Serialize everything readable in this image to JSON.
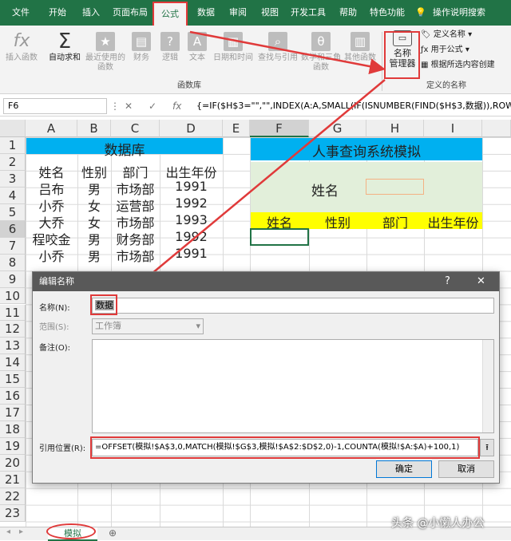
{
  "tabs": [
    "文件",
    "开始",
    "插入",
    "页面布局",
    "公式",
    "数据",
    "审阅",
    "视图",
    "开发工具",
    "帮助",
    "特色功能",
    "操作说明搜索"
  ],
  "ribbon": {
    "func_buttons": [
      {
        "icon": "fx",
        "label": "插入函数"
      },
      {
        "icon": "Σ",
        "label": "自动求和"
      },
      {
        "icon": "★",
        "label": "最近使用的函数"
      },
      {
        "icon": "▤",
        "label": "财务"
      },
      {
        "icon": "?",
        "label": "逻辑"
      },
      {
        "icon": "A",
        "label": "文本"
      },
      {
        "icon": "▦",
        "label": "日期和时间"
      },
      {
        "icon": "⌕",
        "label": "查找与引用"
      },
      {
        "icon": "θ",
        "label": "数学和三角函数"
      },
      {
        "icon": "▥",
        "label": "其他函数"
      }
    ],
    "func_group_label": "函数库",
    "name_manager_line1": "名称",
    "name_manager_line2": "管理器",
    "define_name": "定义名称",
    "use_in_formula": "用于公式",
    "create_from_selection": "根据所选内容创建",
    "defined_names_label": "定义的名称"
  },
  "formula_bar": {
    "name_box": "F6",
    "cancel": "✕",
    "confirm": "✓",
    "fx": "fx",
    "formula": "{=IF($H$3=\"\",\"\",INDEX(A:A,SMALL(IF(ISNUMBER(FIND($H$3,数据)),ROW(数据"
  },
  "columns": [
    "A",
    "B",
    "C",
    "D",
    "E",
    "F",
    "G",
    "H",
    "I"
  ],
  "rows": [
    "1",
    "2",
    "3",
    "4",
    "5",
    "6",
    "7",
    "8",
    "9",
    "10",
    "11",
    "12",
    "13",
    "14",
    "15",
    "16",
    "17",
    "18",
    "19",
    "20",
    "21",
    "22",
    "23"
  ],
  "database": {
    "title": "数据库",
    "headers": [
      "姓名",
      "性别",
      "部门",
      "出生年份"
    ],
    "rows": [
      [
        "吕布",
        "男",
        "市场部",
        "1991"
      ],
      [
        "小乔",
        "女",
        "运营部",
        "1992"
      ],
      [
        "大乔",
        "女",
        "市场部",
        "1993"
      ],
      [
        "程咬金",
        "男",
        "财务部",
        "1992"
      ],
      [
        "小乔",
        "男",
        "市场部",
        "1991"
      ]
    ]
  },
  "query": {
    "title": "人事查询系统模拟",
    "name_label": "姓名",
    "headers": [
      "姓名",
      "性别",
      "部门",
      "出生年份"
    ]
  },
  "dialog": {
    "title": "编辑名称",
    "help": "?",
    "close": "✕",
    "name_label": "名称(N):",
    "name_value": "数据",
    "scope_label": "范围(S):",
    "scope_value": "工作簿",
    "comment_label": "备注(O):",
    "refers_label": "引用位置(R):",
    "refers_value": "=OFFSET(模拟!$A$3,0,MATCH(模拟!$G$3,模拟!$A$2:$D$2,0)-1,COUNTA(模拟!$A:$A)+100,1)",
    "ok": "确定",
    "cancel": "取消"
  },
  "sheet_tab": "模拟",
  "watermark": "头条 @小懒人办公",
  "colors": {
    "excel_green": "#217346",
    "accent_red": "#e03a3a",
    "header_blue": "#00b0f0",
    "query_green": "#e2efda",
    "header_yellow": "#ffff00"
  }
}
